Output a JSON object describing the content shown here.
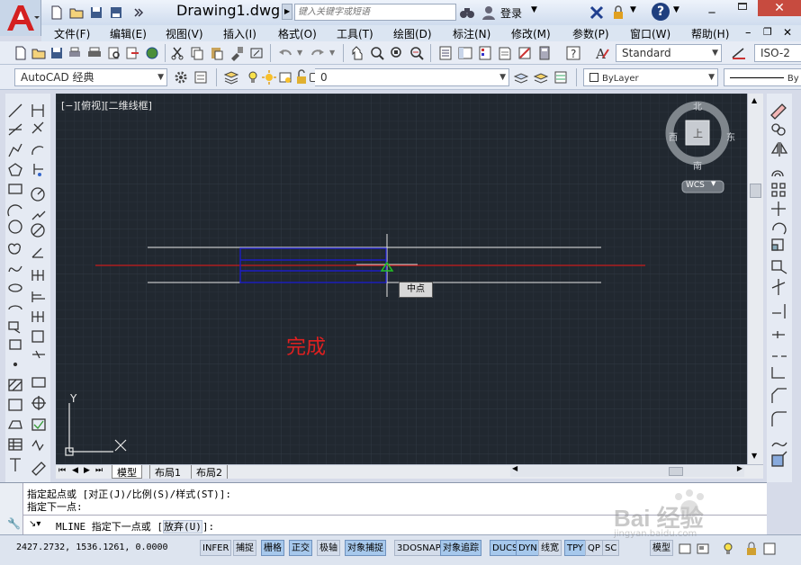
{
  "title_bar": {
    "document_title": "Drawing1.dwg",
    "search_placeholder": "键入关键字或短语",
    "login_label": "登录",
    "help_label": "?"
  },
  "menu": [
    "文件(F)",
    "编辑(E)",
    "视图(V)",
    "插入(I)",
    "格式(O)",
    "工具(T)",
    "绘图(D)",
    "标注(N)",
    "修改(M)",
    "参数(P)",
    "窗口(W)",
    "帮助(H)"
  ],
  "toolbar": {
    "text_style": "Standard",
    "dim_style": "ISO-2",
    "workspace": "AutoCAD 经典",
    "layer_value": "0",
    "color_value": "ByLayer",
    "linetype_value": "By"
  },
  "viewport": {
    "label": "[−][俯视][二维线框]",
    "viewcube": {
      "north": "北",
      "south": "南",
      "west": "西",
      "east": "东",
      "face": "上"
    },
    "wcs_label": "WCS",
    "snap_tooltip": "中点",
    "annotation_text": "完成",
    "ucs_x": "X",
    "ucs_y": "Y",
    "colors": {
      "background": "#212830",
      "mline": "#1c1cc4",
      "centerline": "#c81818",
      "annotation": "#e02020"
    }
  },
  "layout_tabs": [
    "模型",
    "布局1",
    "布局2"
  ],
  "command": {
    "history": [
      "指定起点或 [对正(J)/比例(S)/样式(ST)]:",
      "指定下一点:"
    ],
    "prompt": "MLINE 指定下一点或 [放弃(U)]:",
    "prompt_prefix": "MLINE 指定下一点或 [",
    "prompt_option": "放弃(U)",
    "prompt_suffix": "]:"
  },
  "status": {
    "coordinates": "2427.2732, 1536.1261, 0.0000",
    "toggles": [
      "INFER",
      "捕捉",
      "栅格",
      "正交",
      "极轴",
      "对象捕捉",
      "3DOSNAP",
      "对象追踪",
      "DUCS",
      "DYN",
      "线宽",
      "TPY",
      "QP",
      "SC"
    ],
    "toggles_on": [
      "栅格",
      "正交",
      "对象捕捉",
      "对象追踪",
      "DUCS",
      "DYN",
      "TPY"
    ],
    "model_label": "模型"
  },
  "watermark": {
    "line1": "Bai 经验",
    "line2": "jingyan.baidu.com"
  }
}
